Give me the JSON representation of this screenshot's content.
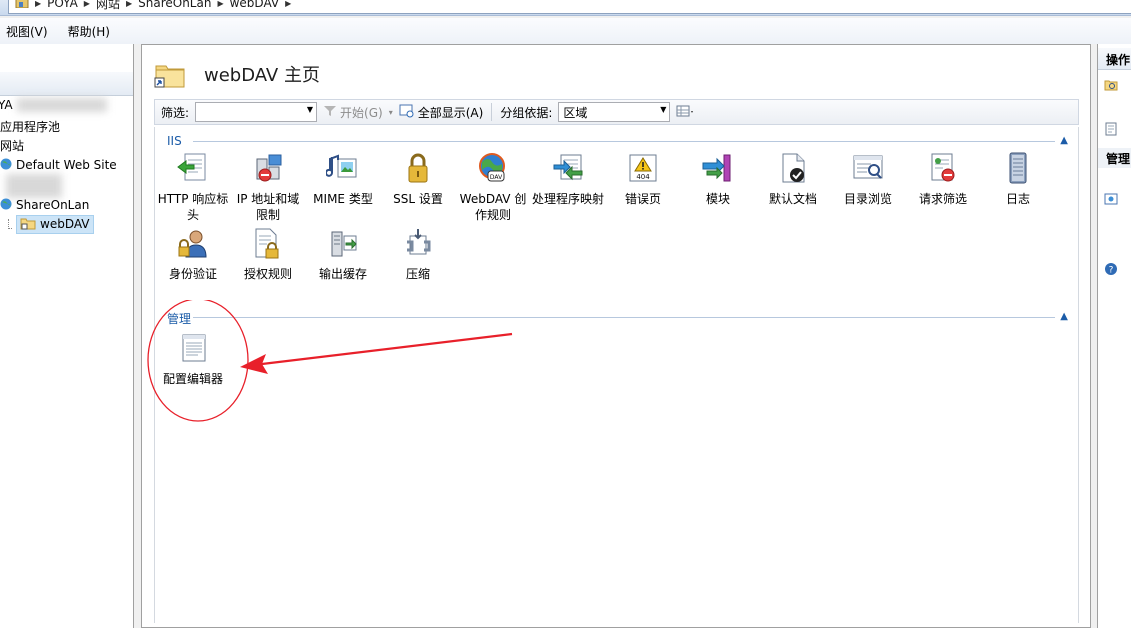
{
  "breadcrumb": {
    "items": [
      "POYA",
      "网站",
      "ShareOnLan",
      "webDAV"
    ]
  },
  "menu": {
    "view": "视图(V)",
    "help": "帮助(H)"
  },
  "tree": {
    "server_partial": "YA",
    "app_pools": "应用程序池",
    "sites": "网站",
    "default_site": "Default Web Site",
    "share_site": "ShareOnLan",
    "selected": "webDAV"
  },
  "main": {
    "title": "webDAV 主页",
    "toolbar": {
      "filter_label": "筛选:",
      "filter_value": "",
      "start": "开始(G)",
      "show_all": "全部显示(A)",
      "group_by_label": "分组依据:",
      "group_by_value": "区域"
    },
    "groups": {
      "iis": "IIS",
      "manage": "管理"
    },
    "iis_features": [
      {
        "label": "HTTP 响应标头",
        "icon": "http-response-headers-icon"
      },
      {
        "label": "IP 地址和域限制",
        "icon": "ip-domain-restrictions-icon"
      },
      {
        "label": "MIME 类型",
        "icon": "mime-types-icon"
      },
      {
        "label": "SSL 设置",
        "icon": "ssl-lock-icon"
      },
      {
        "label": "WebDAV 创作规则",
        "icon": "webdav-globe-icon"
      },
      {
        "label": "处理程序映射",
        "icon": "handler-mappings-icon"
      },
      {
        "label": "错误页",
        "icon": "error-pages-404-icon"
      },
      {
        "label": "模块",
        "icon": "modules-icon"
      },
      {
        "label": "默认文档",
        "icon": "default-document-icon"
      },
      {
        "label": "目录浏览",
        "icon": "directory-browsing-icon"
      },
      {
        "label": "请求筛选",
        "icon": "request-filtering-icon"
      },
      {
        "label": "日志",
        "icon": "logging-icon"
      },
      {
        "label": "身份验证",
        "icon": "authentication-icon"
      },
      {
        "label": "授权规则",
        "icon": "authorization-rules-icon"
      },
      {
        "label": "输出缓存",
        "icon": "output-caching-icon"
      },
      {
        "label": "压缩",
        "icon": "compression-icon"
      }
    ],
    "manage_features": [
      {
        "label": "配置编辑器",
        "icon": "configuration-editor-icon"
      }
    ]
  },
  "actions": {
    "header": "操作",
    "manage": "管理"
  },
  "colors": {
    "group_heading": "#1c5ca8",
    "selection": "#cce4f7",
    "annotation": "#e8202a"
  }
}
